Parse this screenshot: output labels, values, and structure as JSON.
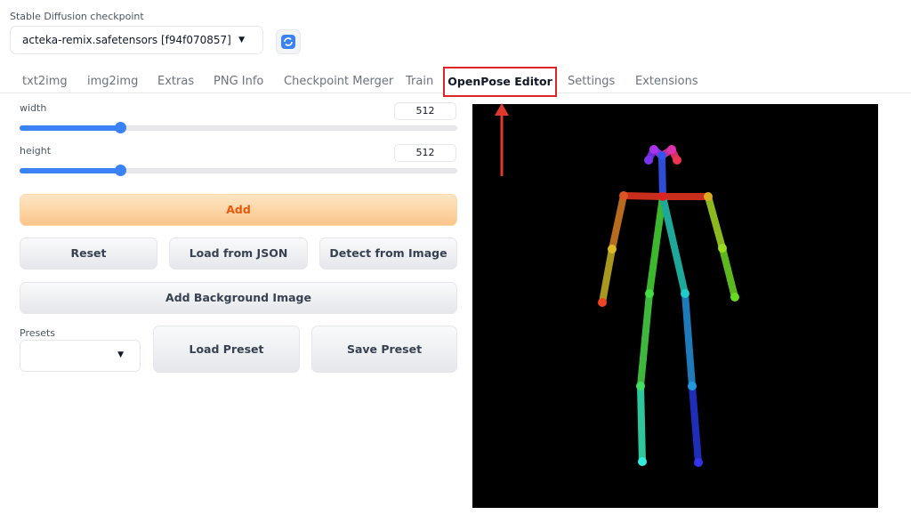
{
  "checkpoint": {
    "label": "Stable Diffusion checkpoint",
    "value": "acteka-remix.safetensors [f94f070857]",
    "refresh_icon": "refresh-icon"
  },
  "tabs": [
    {
      "label": "txt2img"
    },
    {
      "label": "img2img"
    },
    {
      "label": "Extras"
    },
    {
      "label": "PNG Info"
    },
    {
      "label": "Checkpoint Merger"
    },
    {
      "label": "Train"
    },
    {
      "label": "OpenPose Editor",
      "selected": true
    },
    {
      "label": "Settings"
    },
    {
      "label": "Extensions"
    }
  ],
  "controls": {
    "width": {
      "label": "width",
      "value": "512",
      "fill": 0.23
    },
    "height": {
      "label": "height",
      "value": "512",
      "fill": 0.23
    },
    "add_label": "Add",
    "reset_label": "Reset",
    "load_json_label": "Load from JSON",
    "detect_label": "Detect from Image",
    "add_bg_label": "Add Background Image",
    "presets_label": "Presets",
    "presets_value": "",
    "load_preset_label": "Load Preset",
    "save_preset_label": "Save Preset"
  },
  "colors": {
    "accent": "#3b82f6",
    "highlight": "#dc2626",
    "primary_text": "#ea580c"
  }
}
